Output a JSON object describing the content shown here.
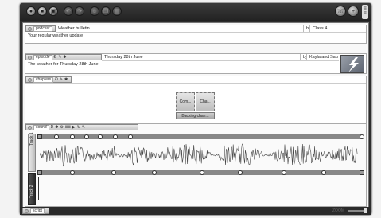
{
  "toolbar": {
    "left_buttons": [
      "record",
      "stop",
      "save",
      "undo",
      "redo",
      "people",
      "copy",
      "paste"
    ],
    "right_buttons": [
      "phone",
      "add",
      "menu"
    ]
  },
  "header_section": {
    "tab_label": "podcast",
    "title": "Weather bulletin",
    "by_label": "by",
    "author": "Class 4",
    "description": "Your regular weather update"
  },
  "episode_section": {
    "tab_label": "episode",
    "title": "Thursday 28th June",
    "by_label": "by",
    "author": "Kayla and Sau",
    "description": "The weather for Thursday 28th June"
  },
  "chapters_section": {
    "tab_label": "chapters",
    "notes": [
      "Com...",
      "Cha..."
    ],
    "backing_label": "Backing chan..."
  },
  "sound_section": {
    "tab_label": "sound",
    "track_labels": [
      "Track 1",
      "Track 2"
    ]
  },
  "status_bar": {
    "tab_label": "script",
    "zoom_label": "ZOOM"
  }
}
